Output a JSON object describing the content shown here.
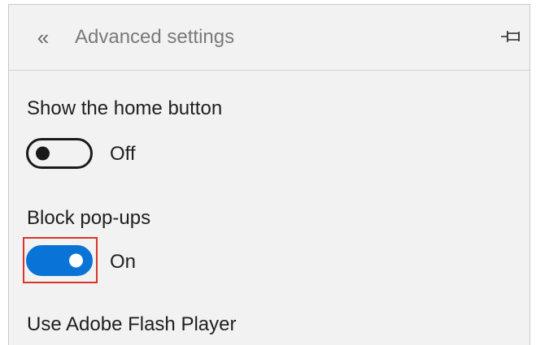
{
  "header": {
    "back_glyph": "«",
    "title": "Advanced settings",
    "back_icon": "double-chevron-left-icon",
    "pin_icon": "pin-icon"
  },
  "settings": [
    {
      "label": "Show the home button",
      "state": "Off",
      "enabled": false
    },
    {
      "label": "Block pop-ups",
      "state": "On",
      "enabled": true
    },
    {
      "label": "Use Adobe Flash Player"
    }
  ],
  "colors": {
    "accent": "#0a74d6",
    "highlight": "#d9362b",
    "panel_bg": "#f2f2f2"
  }
}
